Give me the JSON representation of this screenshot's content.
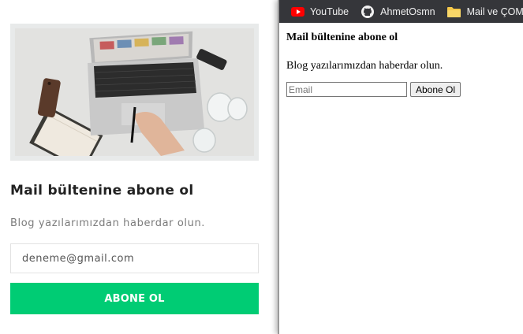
{
  "styled_card": {
    "title": "Mail bültenine abone ol",
    "subtitle": "Blog yazılarımızdan haberdar olun.",
    "email_value": "deneme@gmail.com",
    "button_label": "ABONE OL",
    "accent_color": "#00cc74"
  },
  "browser": {
    "bookmarks": [
      {
        "label": "YouTube",
        "icon": "youtube-icon"
      },
      {
        "label": "AhmetOsmn",
        "icon": "github-icon"
      },
      {
        "label": "Mail ve ÇOMÜ",
        "icon": "folder-icon"
      }
    ],
    "page": {
      "heading": "Mail bültenine abone ol",
      "text": "Blog yazılarımızdan haberdar olun.",
      "input_placeholder": "Email",
      "button_label": "Abone Ol"
    }
  }
}
